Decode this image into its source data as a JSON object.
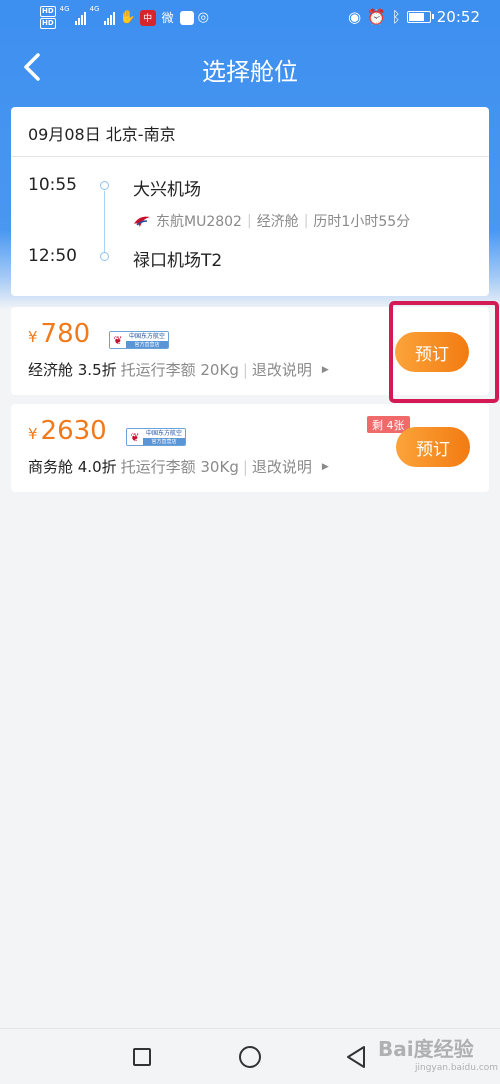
{
  "status_bar": {
    "hd1": "HD",
    "hd2": "HD",
    "net1": "4G",
    "net2": "4G",
    "app1": "中",
    "app2": "微",
    "time": "20:52"
  },
  "nav": {
    "title": "选择舱位"
  },
  "flight": {
    "date_route": "09月08日  北京-南京",
    "depart_time": "10:55",
    "depart_airport": "大兴机场",
    "airline_flight": "东航MU2802",
    "cabin": "经济舱",
    "duration": "历时1小时55分",
    "arrive_time": "12:50",
    "arrive_airport": "禄口机场T2"
  },
  "fares": [
    {
      "currency": "¥",
      "price": "780",
      "logo_line1": "中国东方航空",
      "logo_line2": "官方直营店",
      "class_discount": "经济舱 3.5折",
      "baggage": "托运行李额 20Kg",
      "refund": "退改说明",
      "book_label": "预订"
    },
    {
      "currency": "¥",
      "price": "2630",
      "logo_line1": "中国东方航空",
      "logo_line2": "官方直营店",
      "class_discount": "商务舱 4.0折",
      "baggage": "托运行李额 30Kg",
      "refund": "退改说明",
      "book_label": "预订",
      "remaining": "剩 4张"
    }
  ],
  "watermark": {
    "text": "Bai度经验",
    "sub": "jingyan.baidu.com"
  },
  "colors": {
    "header_blue": "#3d8ff0",
    "price_orange": "#f07a1c",
    "button_orange": "#f27b12",
    "highlight": "#d41a55",
    "remaining_badge": "#f06a6a"
  }
}
